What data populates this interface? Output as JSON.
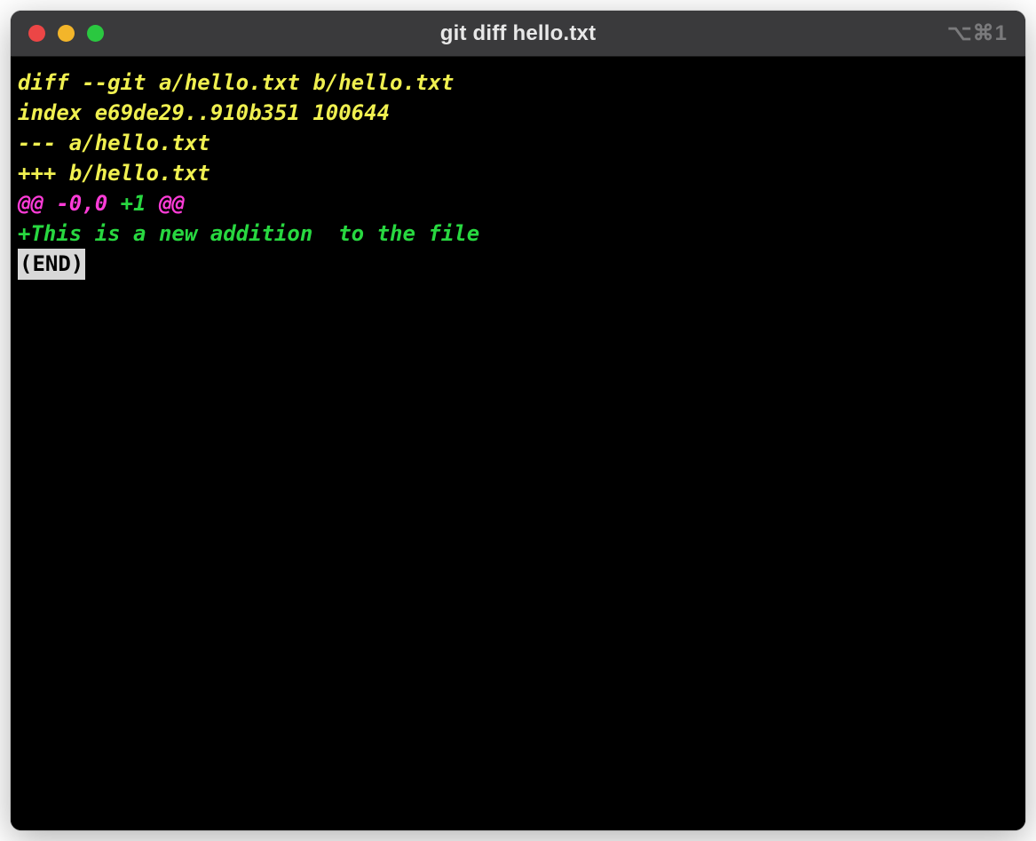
{
  "window": {
    "title": "git diff hello.txt",
    "shortcut": "⌥⌘1"
  },
  "diff": {
    "header1": "diff --git a/hello.txt b/hello.txt",
    "header2": "index e69de29..910b351 100644",
    "header3": "--- a/hello.txt",
    "header4": "+++ b/hello.txt",
    "hunk_at": "@@ -0,0 ",
    "hunk_add": "+1 ",
    "hunk_at2": "@@",
    "addition": "+This is a new addition  to the file",
    "pager_end": "(END)"
  }
}
